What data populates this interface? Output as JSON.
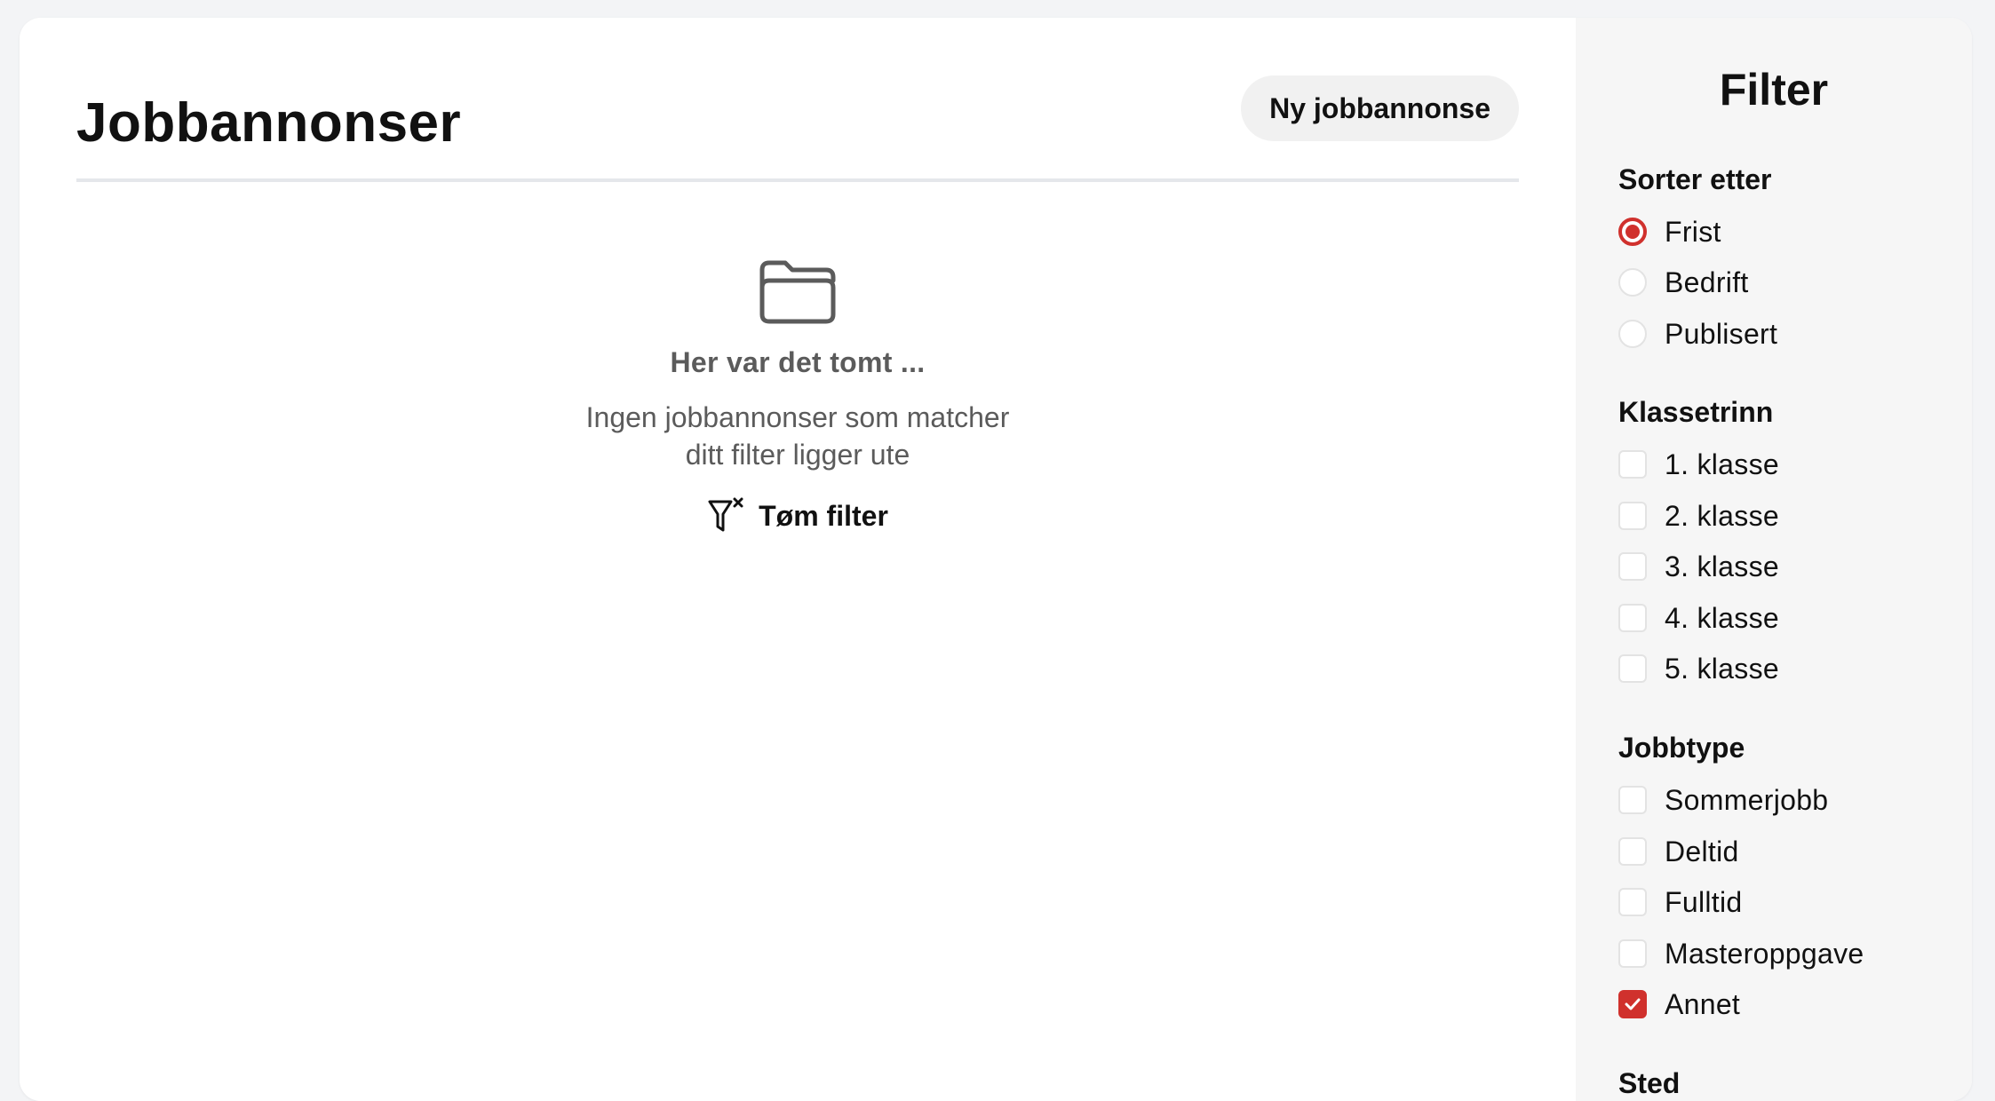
{
  "main": {
    "title": "Jobbannonser",
    "new_button": "Ny jobbannonse",
    "empty_state": {
      "icon": "folder-icon",
      "title": "Her var det tomt ...",
      "text_line1": "Ingen jobbannonser som matcher",
      "text_line2": "ditt filter ligger ute",
      "clear_filter_icon": "filter-clear-icon",
      "clear_filter_label": "Tøm filter"
    }
  },
  "sidebar": {
    "title": "Filter",
    "sort": {
      "title": "Sorter etter",
      "options": [
        {
          "label": "Frist",
          "checked": true
        },
        {
          "label": "Bedrift",
          "checked": false
        },
        {
          "label": "Publisert",
          "checked": false
        }
      ]
    },
    "class": {
      "title": "Klassetrinn",
      "options": [
        {
          "label": "1. klasse",
          "checked": false
        },
        {
          "label": "2. klasse",
          "checked": false
        },
        {
          "label": "3. klasse",
          "checked": false
        },
        {
          "label": "4. klasse",
          "checked": false
        },
        {
          "label": "5. klasse",
          "checked": false
        }
      ]
    },
    "jobtype": {
      "title": "Jobbtype",
      "options": [
        {
          "label": "Sommerjobb",
          "checked": false
        },
        {
          "label": "Deltid",
          "checked": false
        },
        {
          "label": "Fulltid",
          "checked": false
        },
        {
          "label": "Masteroppgave",
          "checked": false
        },
        {
          "label": "Annet",
          "checked": true
        }
      ]
    },
    "location": {
      "title": "Sted"
    }
  },
  "colors": {
    "accent": "#d0312d",
    "muted_text": "#5b5b5b",
    "sidebar_bg": "#f6f6f6",
    "button_bg": "#f1f1f1"
  }
}
